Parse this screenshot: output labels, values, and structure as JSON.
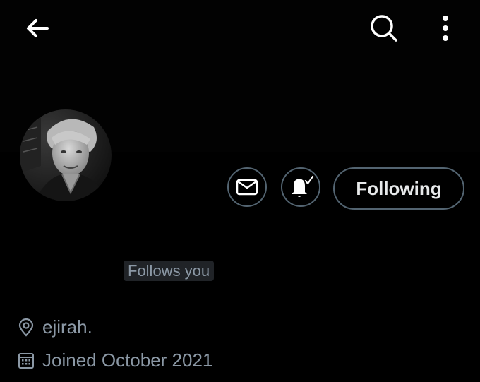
{
  "header": {
    "back_icon": "arrow-left-icon",
    "search_icon": "search-icon",
    "more_icon": "more-vertical-icon"
  },
  "profile": {
    "avatar": "profile-photo",
    "actions": {
      "message_icon": "envelope-icon",
      "notify_icon": "bell-check-icon",
      "following_label": "Following"
    },
    "follows_you_label": "Follows you",
    "location_icon": "location-pin-icon",
    "location": "ejirah.",
    "joined_icon": "calendar-icon",
    "joined": "Joined October 2021"
  },
  "colors": {
    "background": "#000000",
    "text": "#e7e9ea",
    "muted_text": "#8b98a5",
    "border": "#536471",
    "badge_bg": "#202327"
  }
}
